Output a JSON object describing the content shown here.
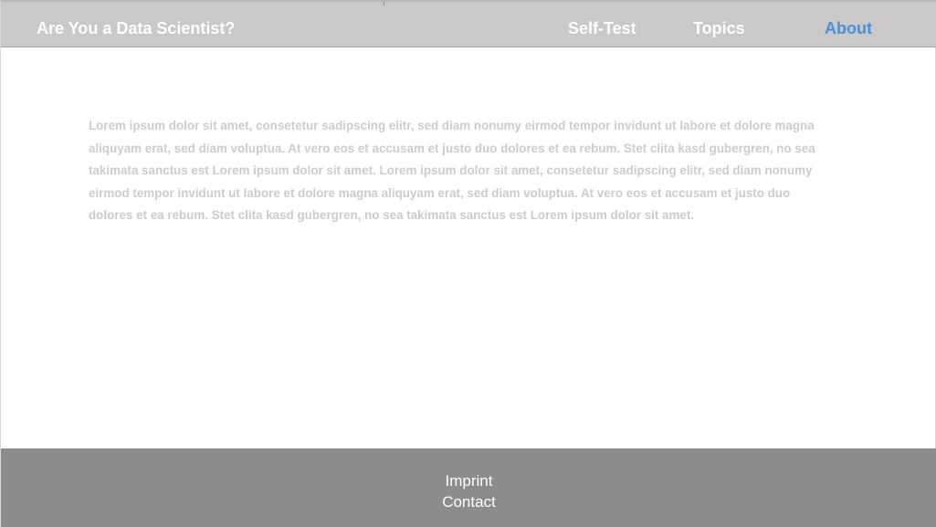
{
  "header": {
    "site_title": "Are You a Data Scientist?",
    "nav": {
      "self_test": "Self-Test",
      "topics": "Topics",
      "about": "About"
    },
    "active_color": "#4a90d9"
  },
  "main": {
    "paragraph": "Lorem ipsum dolor sit amet, consetetur sadipscing elitr, sed diam nonumy eirmod tempor invidunt ut labore et dolore magna aliquyam erat, sed diam voluptua. At vero eos et accusam et justo duo dolores et ea rebum. Stet clita kasd gubergren, no sea takimata sanctus est Lorem ipsum dolor sit amet. Lorem ipsum dolor sit amet, consetetur sadipscing elitr, sed diam nonumy eirmod tempor invidunt ut labore et dolore magna aliquyam erat, sed diam voluptua. At vero eos et accusam et justo duo dolores et ea rebum. Stet clita kasd gubergren, no sea takimata sanctus est Lorem ipsum dolor sit amet."
  },
  "footer": {
    "imprint": "Imprint",
    "contact": "Contact"
  }
}
